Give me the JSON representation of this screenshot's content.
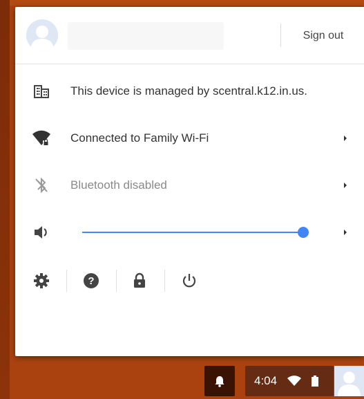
{
  "header": {
    "account_name": "",
    "sign_out_label": "Sign out"
  },
  "managed": {
    "text": "This device is managed by scentral.k12.in.us.",
    "icon": "building-icon"
  },
  "wifi": {
    "text": "Connected to Family Wi-Fi",
    "icon": "wifi-lock-icon"
  },
  "bluetooth": {
    "text": "Bluetooth disabled",
    "icon": "bluetooth-disabled-icon"
  },
  "volume": {
    "icon": "speaker-icon",
    "level_percent": 100
  },
  "bottom_buttons": [
    {
      "name": "settings",
      "icon": "gear-icon"
    },
    {
      "name": "help",
      "icon": "help-icon"
    },
    {
      "name": "lock",
      "icon": "lock-icon"
    },
    {
      "name": "power",
      "icon": "power-icon"
    }
  ],
  "shelf": {
    "time": "4:04",
    "icons": [
      "notification-bell-icon",
      "wifi-icon",
      "battery-icon"
    ]
  },
  "colors": {
    "accent": "#4285f4",
    "wallpaper": "#a9420f",
    "panel": "#ffffff",
    "text": "#333333",
    "muted_text": "#8a8a8a"
  }
}
